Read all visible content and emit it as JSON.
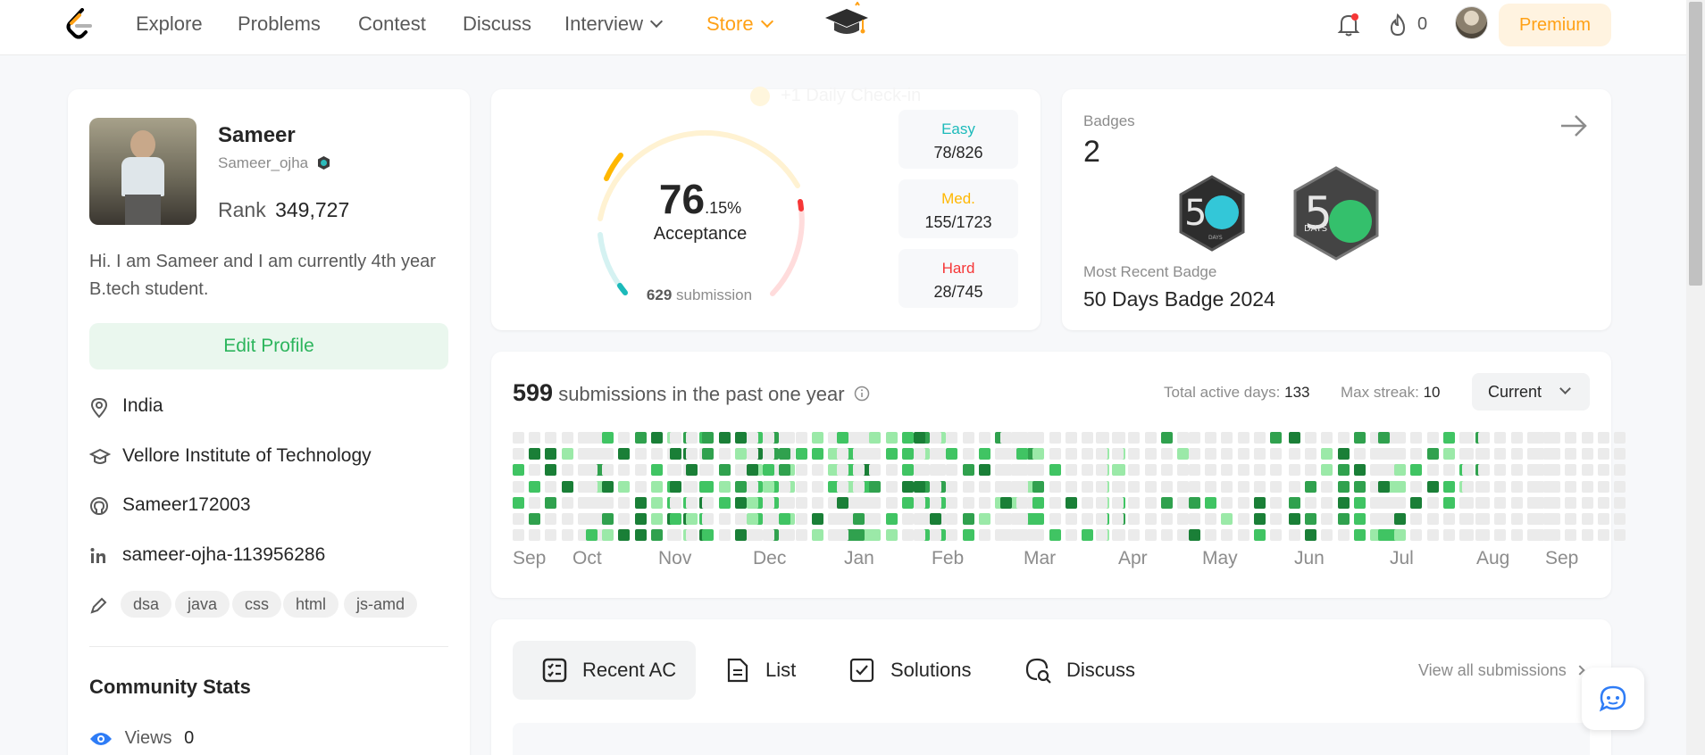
{
  "nav": {
    "items": [
      {
        "label": "Explore"
      },
      {
        "label": "Problems"
      },
      {
        "label": "Contest"
      },
      {
        "label": "Discuss"
      },
      {
        "label": "Interview"
      },
      {
        "label": "Store"
      }
    ],
    "streak_count": "0",
    "premium_label": "Premium",
    "colors": {
      "brand": "#ffa116",
      "text": "#595959"
    }
  },
  "profile": {
    "name": "Sameer",
    "username": "Sameer_ojha",
    "rank_label": "Rank",
    "rank_value": "349,727",
    "bio": "Hi. I am Sameer and I am currently 4th year B.tech student.",
    "edit_button": "Edit Profile",
    "location": "India",
    "school": "Vellore Institute of Technology",
    "github": "Sameer172003",
    "linkedin": "sameer-ojha-113956286",
    "skills": [
      "dsa",
      "java",
      "css",
      "html",
      "js-amd"
    ],
    "community_title": "Community Stats",
    "views_label": "Views",
    "views_value": "0"
  },
  "progress": {
    "ghost_text": "+1 Daily Check-in",
    "acceptance_int": "76",
    "acceptance_dec": ".15%",
    "acceptance_label": "Acceptance",
    "submission_count": "629",
    "submission_label": "submission",
    "difficulties": [
      {
        "label": "Easy",
        "value": "78/826",
        "color": "#1cbaba"
      },
      {
        "label": "Med.",
        "value": "155/1723",
        "color": "#ffb700"
      },
      {
        "label": "Hard",
        "value": "28/745",
        "color": "#f63737"
      }
    ]
  },
  "badges": {
    "title": "Badges",
    "count": "2",
    "recent_label": "Most Recent Badge",
    "recent_name": "50 Days Badge 2024",
    "items": [
      {
        "icon": "badge-50-days-icon",
        "text": "DAYS"
      },
      {
        "icon": "badge-50-days-2024-icon",
        "text": "DAYS"
      }
    ]
  },
  "calendar": {
    "count": "599",
    "text": "submissions in the past one year",
    "active_days_label": "Total active days:",
    "active_days": "133",
    "max_streak_label": "Max streak:",
    "max_streak": "10",
    "select_value": "Current",
    "months": [
      "Sep",
      "Oct",
      "Nov",
      "Dec",
      "Jan",
      "Feb",
      "Mar",
      "Apr",
      "May",
      "Jun",
      "Jul",
      "Aug",
      "Sep"
    ],
    "colors": {
      "0": "#ebebeb",
      "1": "#9be9a8",
      "2": "#40c463",
      "3": "#30a14e",
      "4": "#1a7f37"
    }
  },
  "tabs": {
    "items": [
      {
        "label": "Recent AC"
      },
      {
        "label": "List"
      },
      {
        "label": "Solutions"
      },
      {
        "label": "Discuss"
      }
    ],
    "view_all": "View all submissions"
  }
}
